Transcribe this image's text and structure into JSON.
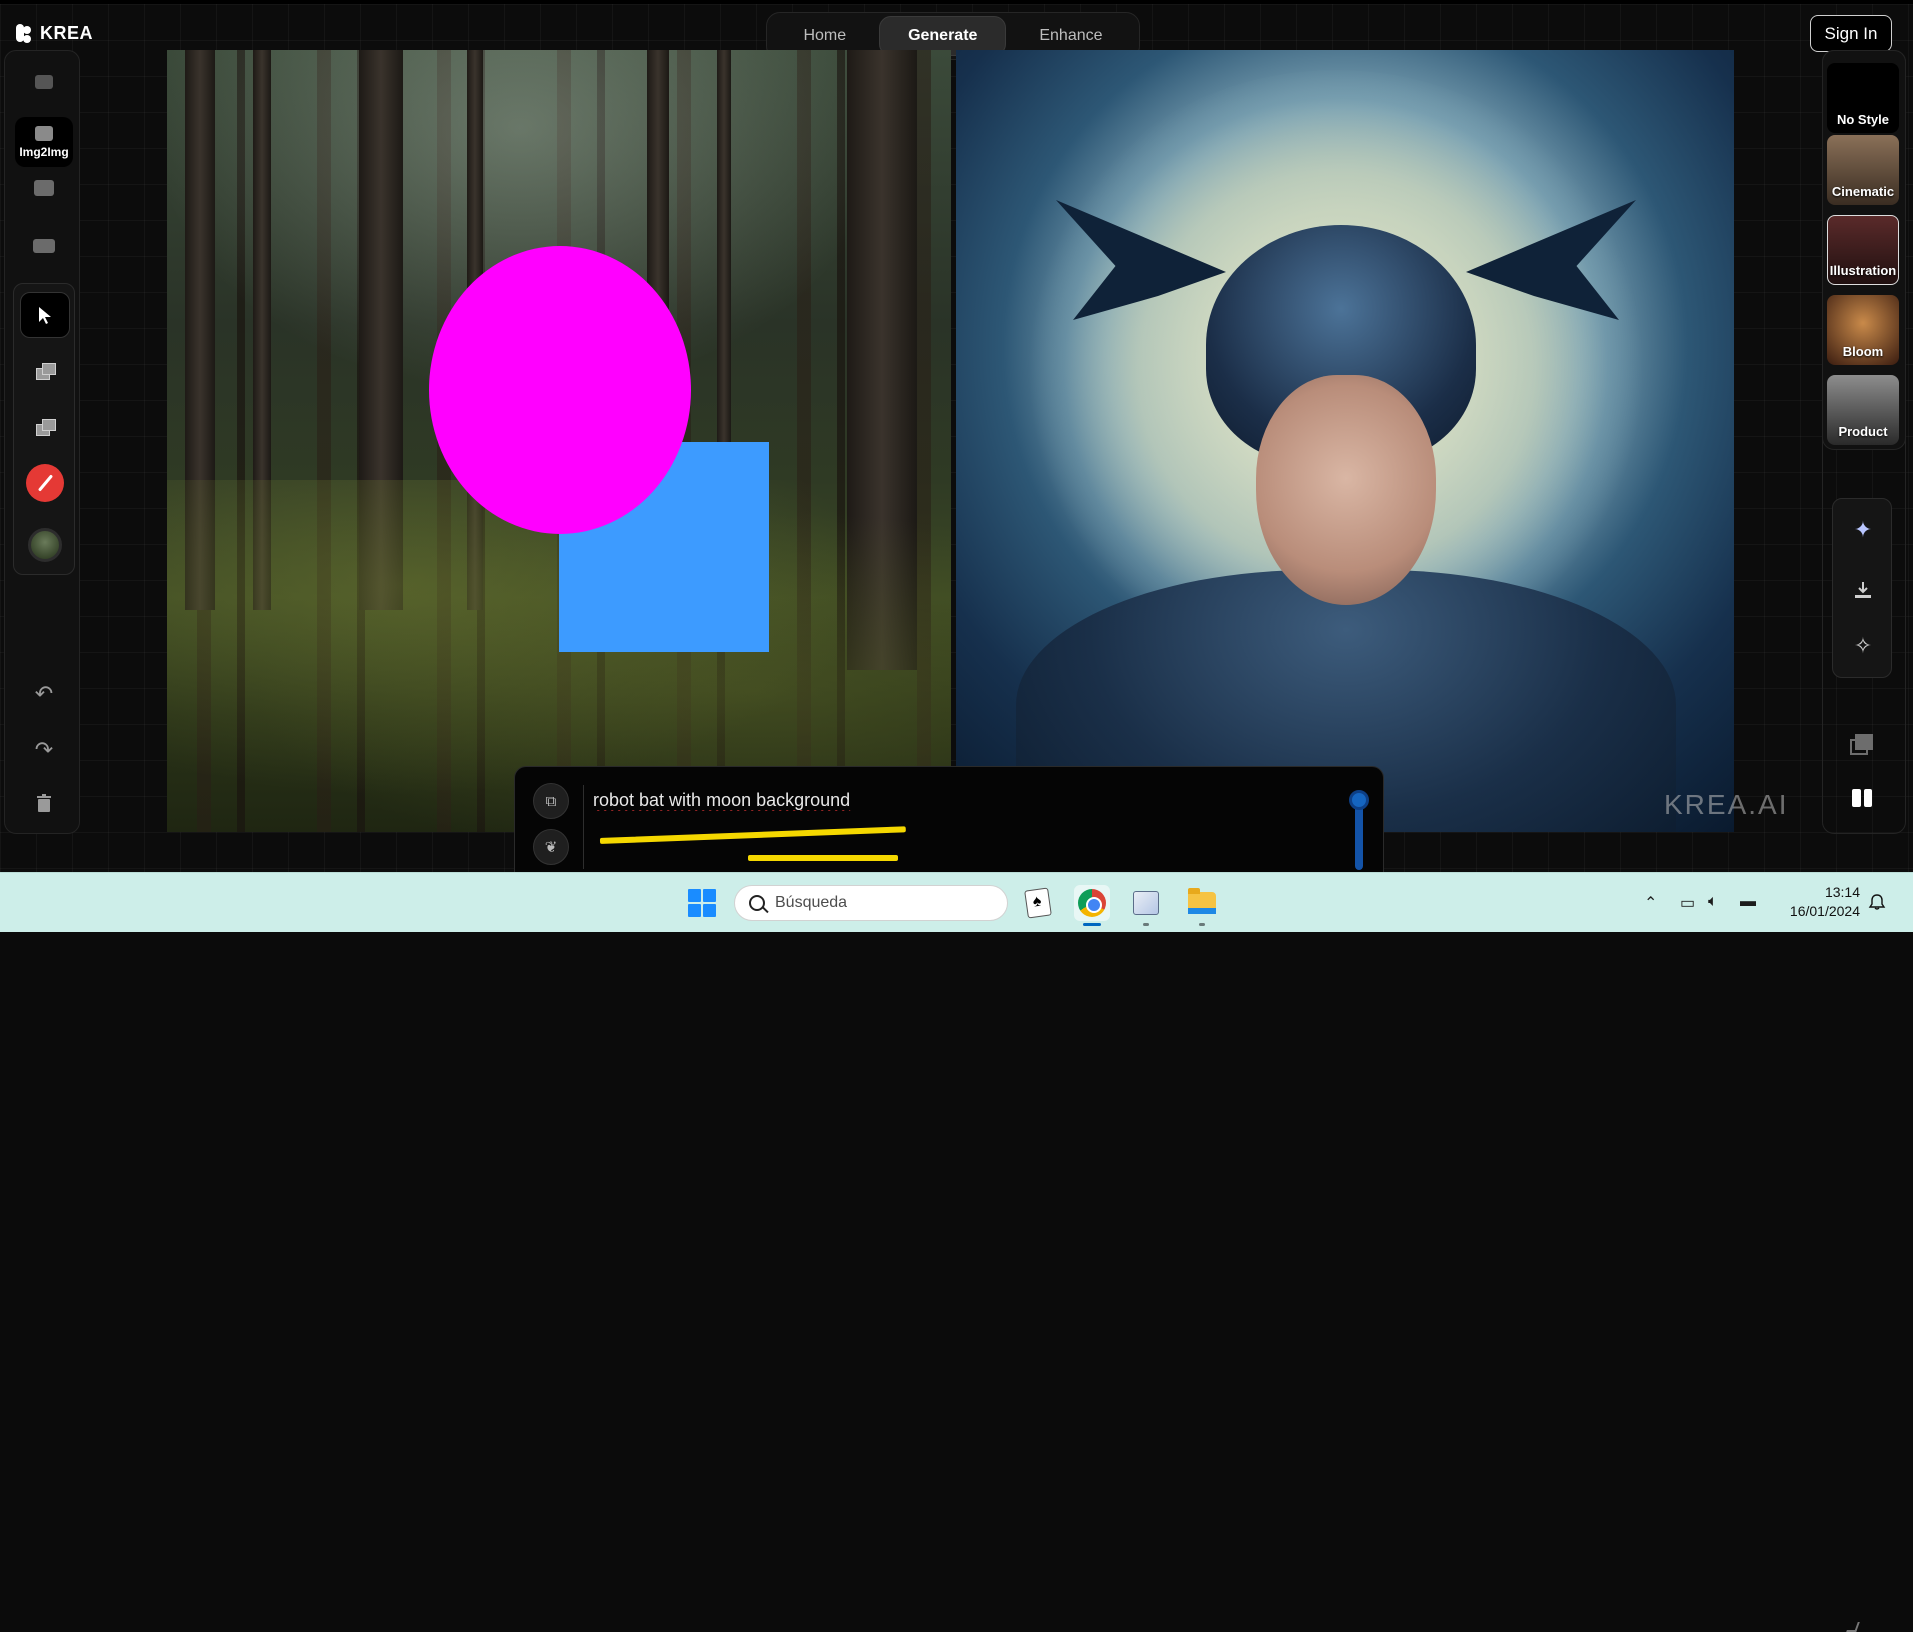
{
  "app": {
    "brand": "KREA"
  },
  "nav": {
    "tabs": [
      "Home",
      "Generate",
      "Enhance"
    ],
    "active": "Generate"
  },
  "header": {
    "sign_in": "Sign In"
  },
  "left_toolbar": {
    "modes": [
      {
        "icon": "ai-mode-icon",
        "label": ""
      },
      {
        "icon": "image-icon",
        "label": "Img2Img"
      },
      {
        "icon": "screen-icon",
        "label": ""
      },
      {
        "icon": "video-icon",
        "label": ""
      }
    ],
    "tools": [
      "select-tool-icon",
      "shapes-icon",
      "image-add-icon",
      "brush-icon",
      "background-image-icon"
    ],
    "history": [
      "undo-icon",
      "redo-icon",
      "trash-icon"
    ]
  },
  "canvas": {
    "shapes": [
      {
        "kind": "ellipse",
        "color": "#ff00ff"
      },
      {
        "kind": "square",
        "color": "#3d9bff"
      }
    ],
    "watermark": "KREA.AI"
  },
  "styles": [
    "No Style",
    "Cinematic",
    "Illustration",
    "Bloom",
    "Product"
  ],
  "actions": [
    "enhance-sparkle-icon",
    "download-icon",
    "magic-wand-icon"
  ],
  "view": [
    "layers-icon",
    "split-view-icon"
  ],
  "prompt": {
    "text": "robot bat with moon background",
    "strength": 1.0
  },
  "taskbar": {
    "search_placeholder": "Búsqueda",
    "time": "13:14",
    "date": "16/01/2024",
    "apps": [
      "solitaire-icon",
      "chrome-icon",
      "paint-icon",
      "file-explorer-icon"
    ]
  }
}
